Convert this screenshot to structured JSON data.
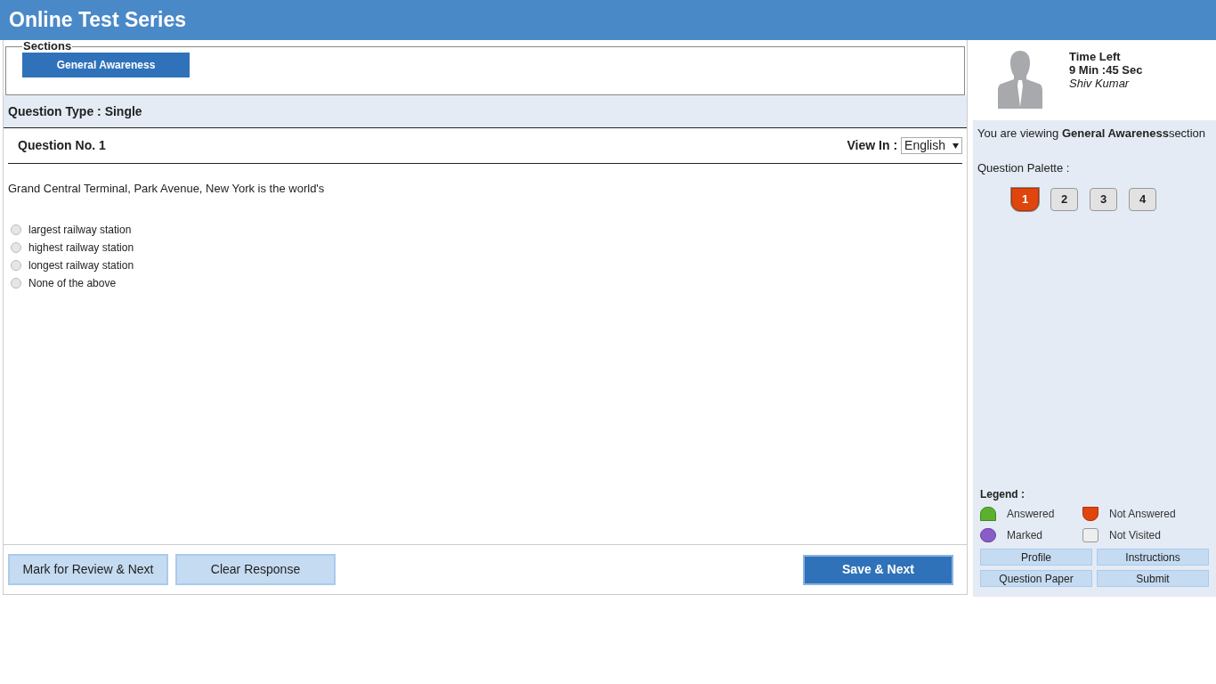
{
  "header": {
    "title": "Online Test Series"
  },
  "sections": {
    "legend": "Sections",
    "tabs": [
      {
        "label": "General Awareness",
        "selected": true
      }
    ]
  },
  "question_type": "Question Type : Single",
  "question": {
    "number": "Question No. 1",
    "view_in_label": "View In :",
    "language": "English",
    "text": "Grand Central Terminal, Park Avenue, New York is the world's",
    "options": [
      {
        "label": "largest railway station",
        "selected": false
      },
      {
        "label": "highest railway station",
        "selected": false
      },
      {
        "label": "longest railway station",
        "selected": false
      },
      {
        "label": "None of the above",
        "selected": false
      }
    ]
  },
  "footer_buttons": {
    "mark_review": "Mark for Review & Next",
    "clear": "Clear Response",
    "save": "Save & Next"
  },
  "candidate": {
    "time_label": "Time Left",
    "time": "9 Min :45 Sec",
    "name": "Shiv Kumar"
  },
  "viewing": "You are viewing **General Awareness**section",
  "palette": {
    "label": "Question Palette :",
    "items": [
      {
        "number": "1",
        "kind": "not_answered",
        "selected": true
      },
      {
        "number": "2",
        "kind": "not_visited",
        "selected": false
      },
      {
        "number": "3",
        "kind": "not_visited",
        "selected": false
      },
      {
        "number": "4",
        "kind": "not_visited",
        "selected": false
      }
    ]
  },
  "legend": {
    "title": "Legend :",
    "items": [
      {
        "kind": "answered",
        "label": "Answered"
      },
      {
        "kind": "not_answered",
        "label": "Not Answered"
      },
      {
        "kind": "marked",
        "label": "Marked"
      },
      {
        "kind": "not_visited",
        "label": "Not Visited"
      }
    ]
  },
  "side_buttons": [
    "Profile",
    "Instructions",
    "Question Paper",
    "Submit"
  ]
}
